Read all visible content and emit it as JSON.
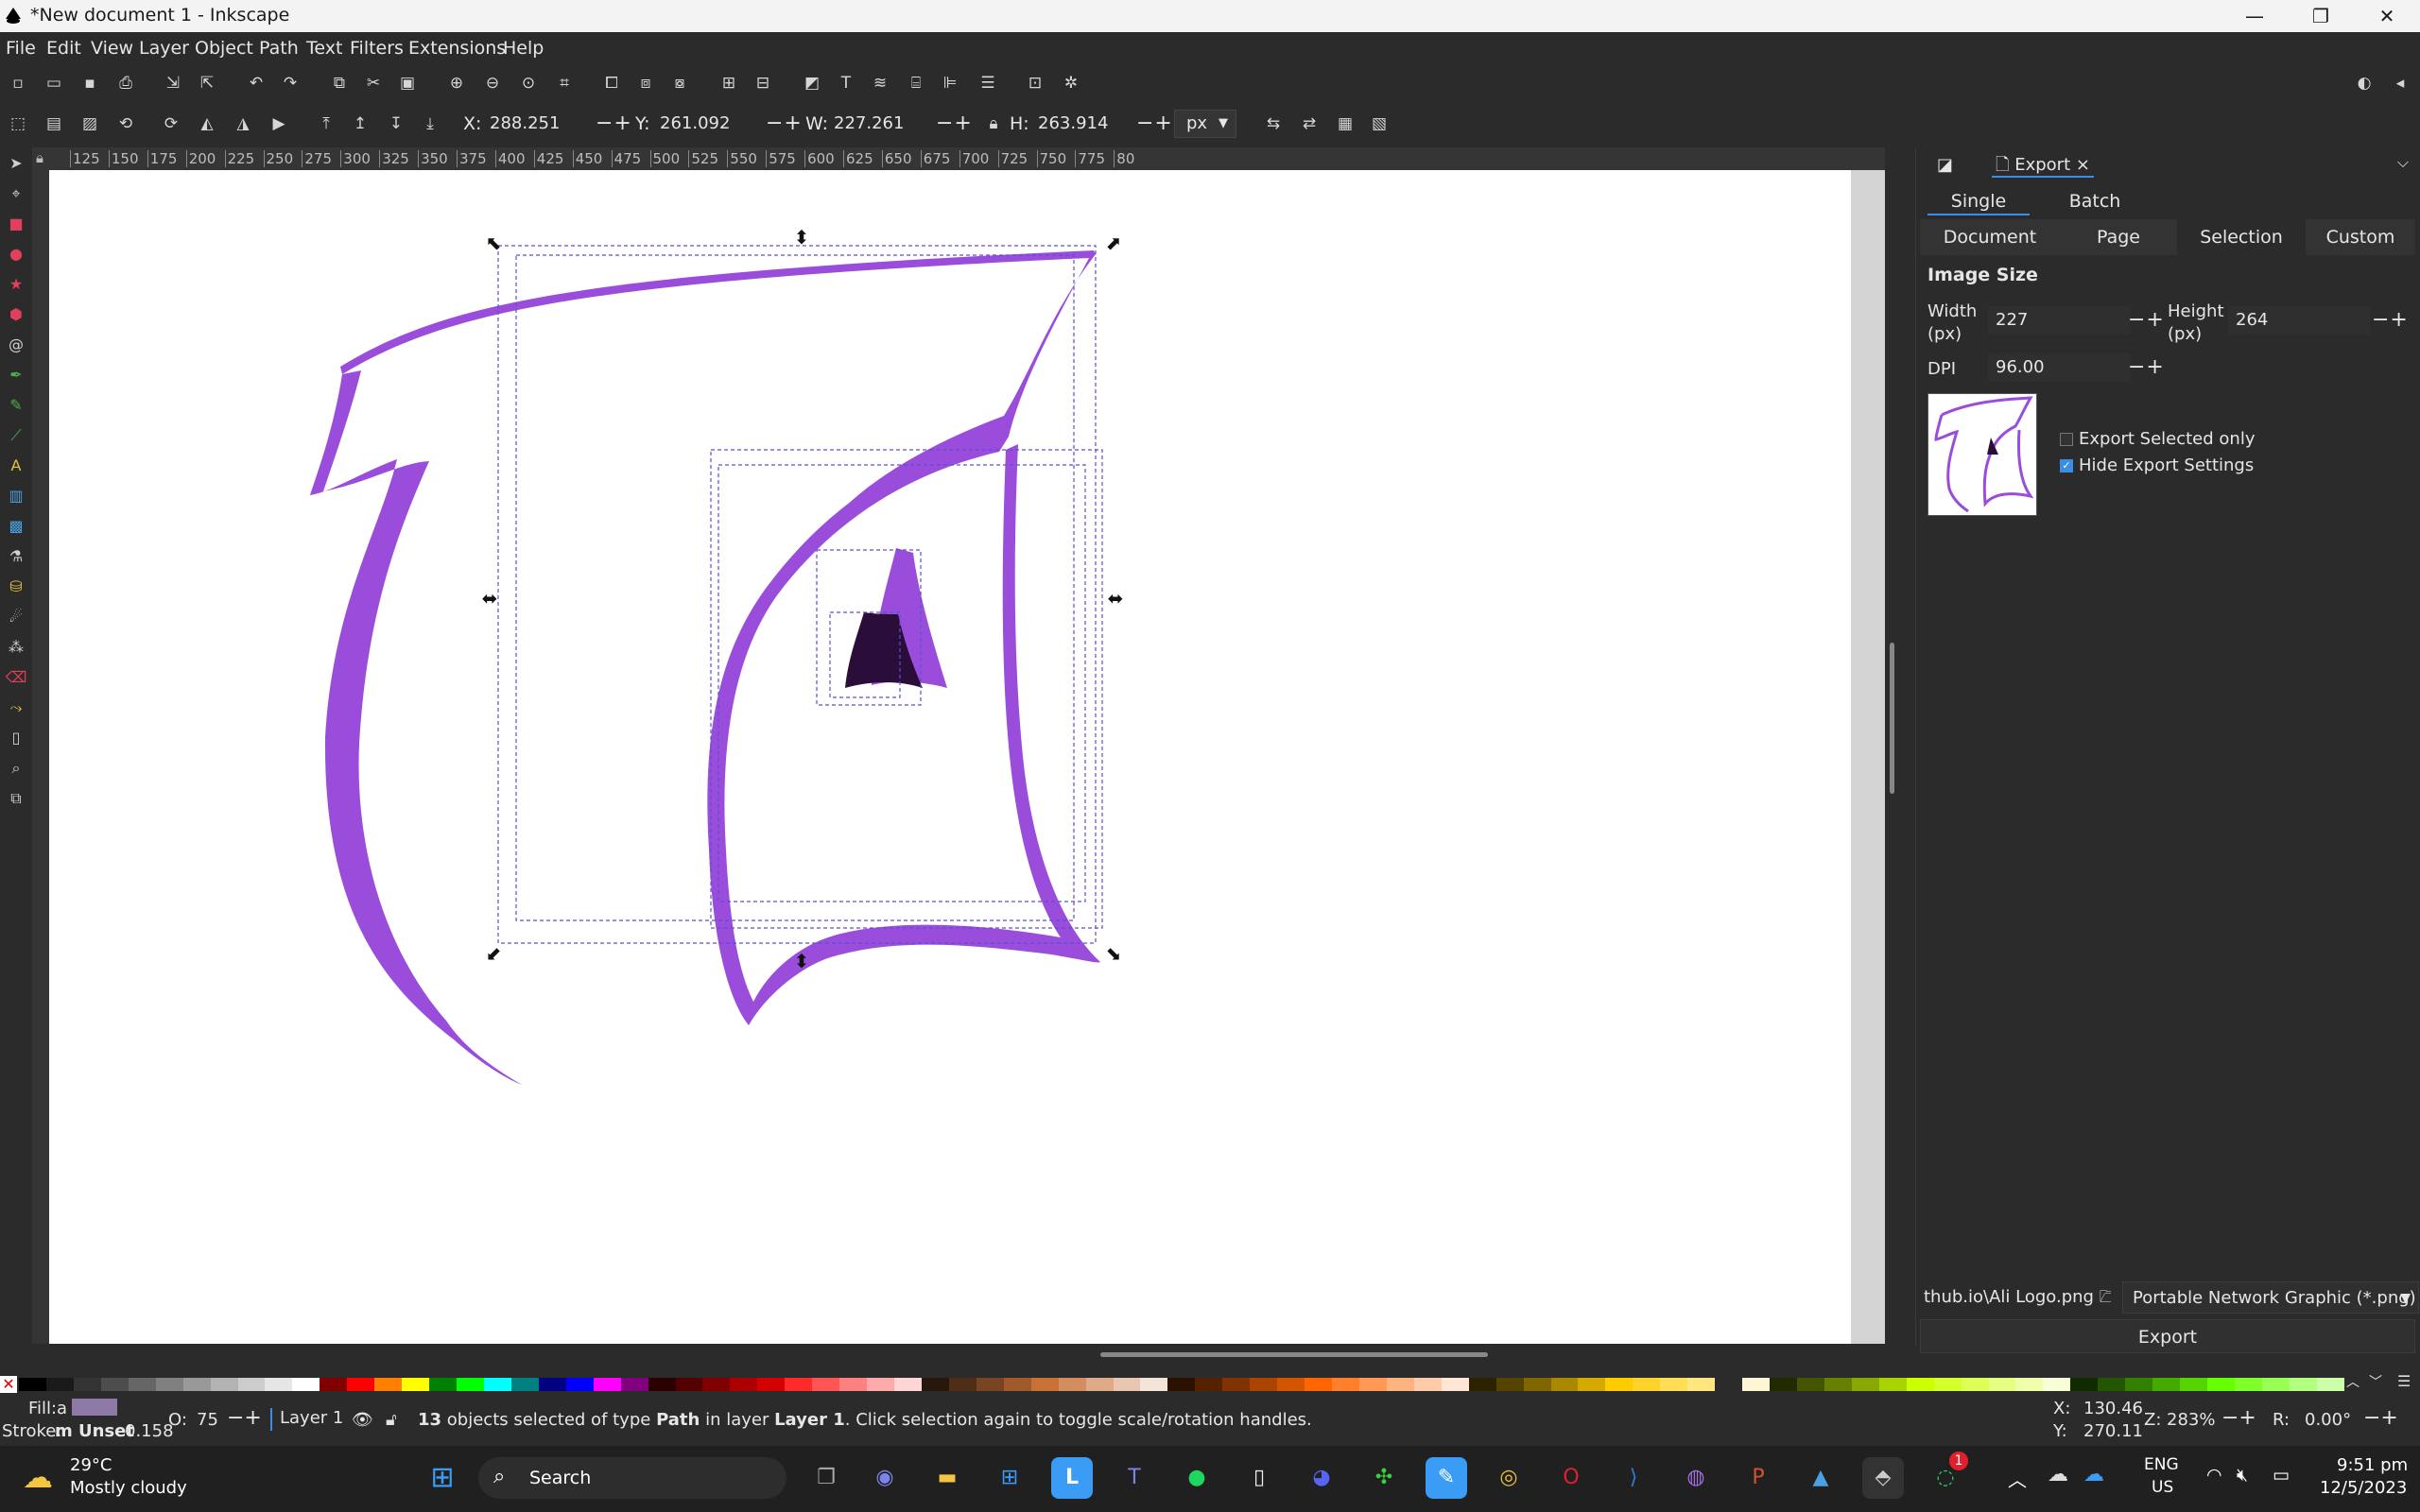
{
  "window": {
    "title": "*New document 1 - Inkscape",
    "controls": {
      "minimize": "—",
      "maximize": "❐",
      "close": "✕"
    }
  },
  "menu": [
    "File",
    "Edit",
    "View",
    "Layer",
    "Object",
    "Path",
    "Text",
    "Filters",
    "Extensions",
    "Help"
  ],
  "select_toolbar": {
    "x_label": "X:",
    "x_value": "288.251",
    "y_label": "Y:",
    "y_value": "261.092",
    "w_label": "W:",
    "w_value": "227.261",
    "h_label": "H:",
    "h_value": "263.914",
    "unit": "px",
    "stepper": "−+"
  },
  "ruler_ticks": [
    "125",
    "150",
    "175",
    "200",
    "225",
    "250",
    "275",
    "300",
    "325",
    "350",
    "375",
    "400",
    "425",
    "450",
    "475",
    "500",
    "525",
    "550",
    "575",
    "600",
    "625",
    "650",
    "675",
    "700",
    "725",
    "750",
    "775",
    "80"
  ],
  "export_panel": {
    "tab_label": "Export",
    "tab_close": "×",
    "mode_tabs": [
      "Single Image",
      "Batch Export"
    ],
    "area_tabs": [
      "Document",
      "Page",
      "Selection",
      "Custom"
    ],
    "active_area": "Selection",
    "section_title": "Image Size",
    "width_label": "Width\n(px)",
    "width_value": "227",
    "height_label": "Height\n(px)",
    "height_value": "264",
    "dpi_label": "DPI",
    "dpi_value": "96.00",
    "stepper": "−+",
    "export_selected_only": "Export Selected only",
    "export_selected_checked": false,
    "hide_export_settings": "Hide Export Settings",
    "hide_export_checked": true,
    "filename": "thub.io\\Ali Logo.png",
    "file_type": "Portable Network Graphic (*.png)",
    "export_button": "Export"
  },
  "status": {
    "fill_label": "Fill:",
    "fill_value": "a",
    "stroke_label": "Stroke:",
    "stroke_value": "m Unset",
    "stroke_width": "0.158",
    "opacity_label": "O:",
    "opacity_value": "75",
    "layer": "Layer 1",
    "message_count": "13",
    "message_part1": " objects selected of type ",
    "message_type": "Path",
    "message_part2": " in layer ",
    "message_layer": "Layer 1",
    "message_part3": ". Click selection again to toggle scale/rotation handles.",
    "cursor_x_label": "X:",
    "cursor_x": "130.46",
    "cursor_y_label": "Y:",
    "cursor_y": "270.11",
    "zoom_label": "Z:",
    "zoom": "283%",
    "rotate_label": "R:",
    "rotate": "0.00°",
    "stepper": "−+"
  },
  "taskbar": {
    "weather_temp": "29°C",
    "weather_desc": "Mostly cloudy",
    "search_label": "Search",
    "notification_badge": "1",
    "lang": "ENG",
    "region": "US",
    "time": "9:51 pm",
    "date": "12/5/2023"
  },
  "colors": {
    "accent": "#9a4ddb",
    "purple_dark": "#2b0d3a",
    "bg": "#2b2b2b",
    "selection_dash": "#5b4fd6"
  }
}
